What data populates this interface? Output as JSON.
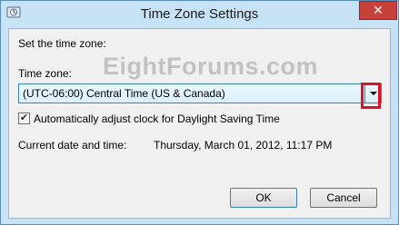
{
  "window": {
    "title": "Time Zone Settings",
    "close_label": "✕"
  },
  "content": {
    "section_label": "Set the time zone:",
    "time_zone_label": "Time zone:",
    "time_zone_value": "(UTC-06:00) Central Time (US & Canada)",
    "dst_checkbox_label": "Automatically adjust clock for Daylight Saving Time",
    "dst_checked": true,
    "current_datetime_label": "Current date and time:",
    "current_datetime_value": "Thursday, March 01, 2012, 11:17 PM",
    "watermark": "EightForums.com"
  },
  "buttons": {
    "ok": "OK",
    "cancel": "Cancel"
  },
  "colors": {
    "frame": "#c6e2f4",
    "close_button": "#c7403a",
    "highlight": "#d9132a",
    "select_border": "#3c7fb1"
  }
}
